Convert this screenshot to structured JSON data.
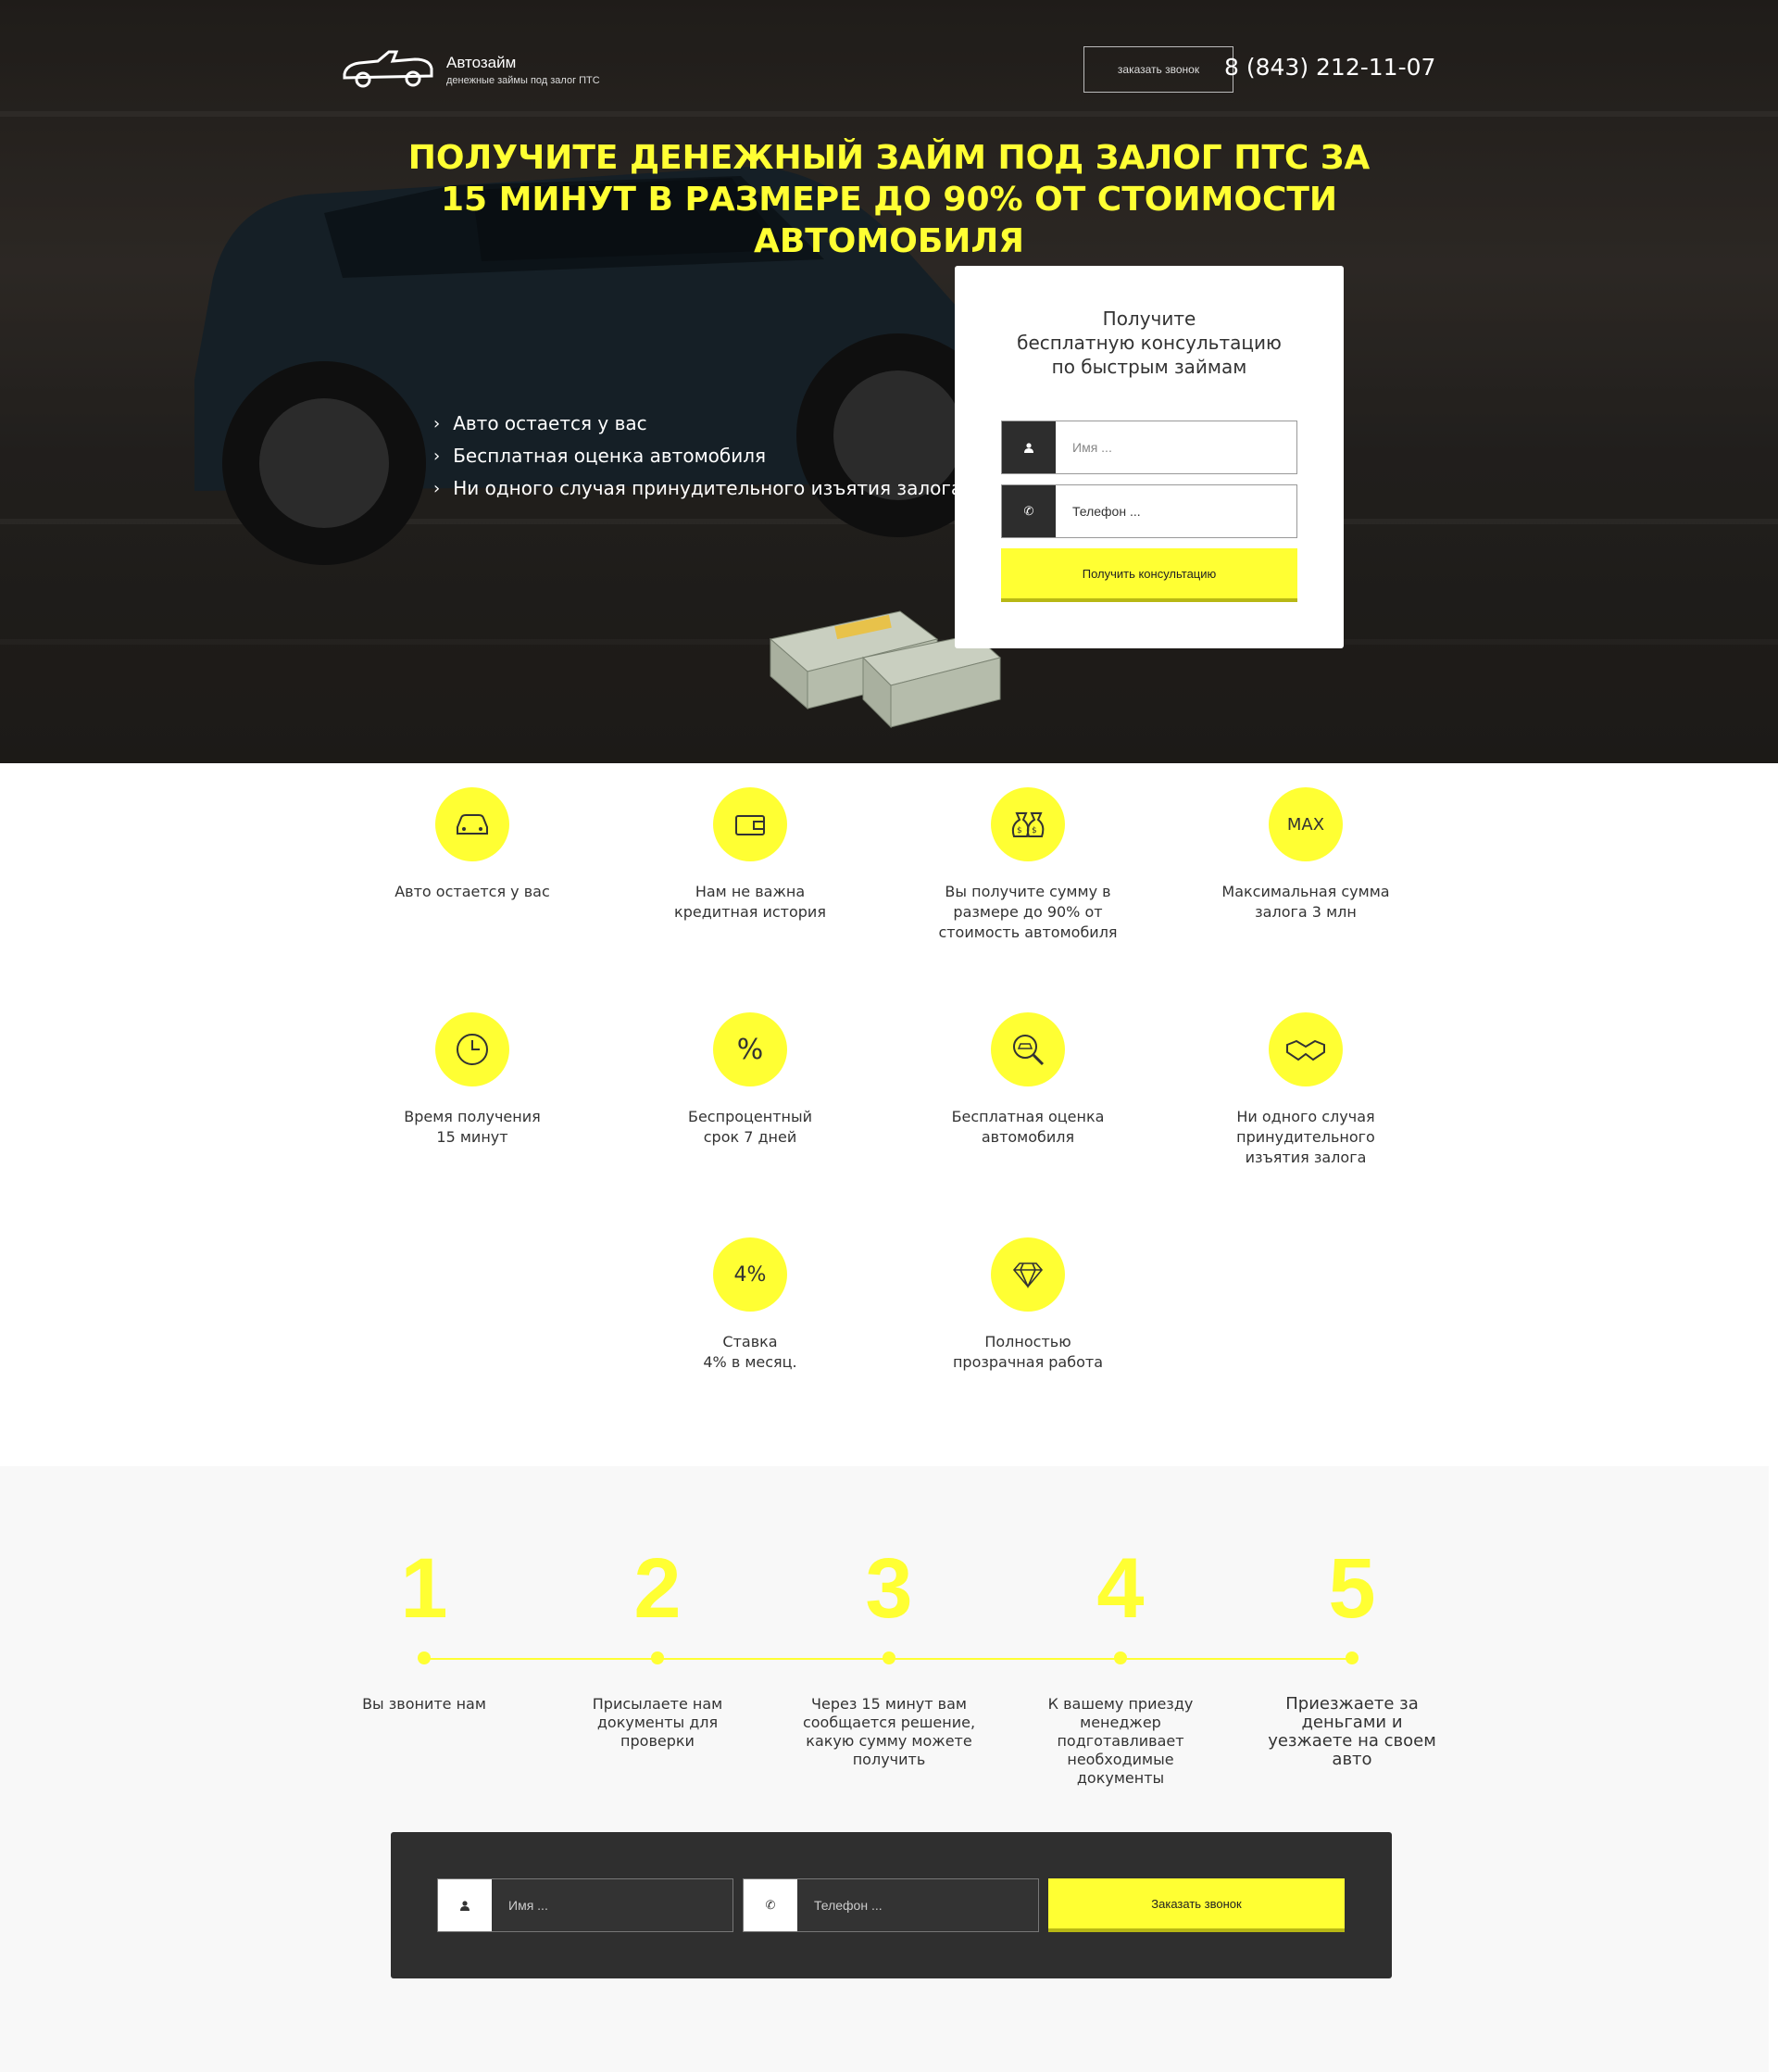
{
  "header": {
    "logo_title": "Автозайм",
    "logo_subtitle": "денежные займы под залог ПТС",
    "callback_button": "заказать звонок",
    "phone": "8 (843) 212-11-07"
  },
  "hero": {
    "headline": "Получите денежный займ под залог ПТС за 15 минут в размере до 90% от стоимости автомобиля",
    "bullets": [
      "Авто остается у вас",
      "Бесплатная оценка автомобиля",
      "Ни одного случая принудительного изъятия залога"
    ]
  },
  "form": {
    "title_line1": "Получите",
    "title_line2": "бесплатную консультацию",
    "title_line3": "по быстрым займам",
    "name_placeholder": "Имя ...",
    "phone_placeholder": "Телефон ...",
    "submit": "Получить консультацию"
  },
  "features": [
    {
      "icon": "car-icon",
      "label": "Авто остается у вас"
    },
    {
      "icon": "wallet-icon",
      "label": "Нам не важна\nкредитная история"
    },
    {
      "icon": "money-bags-icon",
      "label": "Вы получите сумму в\nразмере до 90% от\nстоимость автомобиля"
    },
    {
      "icon": "max-icon",
      "icon_text": "MAX",
      "label": "Максимальная сумма\nзалога 3 млн"
    },
    {
      "icon": "clock-icon",
      "label": "Время получения\n15 минут"
    },
    {
      "icon": "percent-icon",
      "icon_text": "%",
      "label": "Беспроцентный\nсрок 7 дней"
    },
    {
      "icon": "car-search-icon",
      "label": "Бесплатная оценка\nавтомобиля"
    },
    {
      "icon": "handshake-icon",
      "label": "Ни одного случая\nпринудительного\nизъятия залога"
    },
    {
      "icon": "rate-icon",
      "icon_text": "4%",
      "label": "Ставка\n4% в месяц."
    },
    {
      "icon": "diamond-icon",
      "label": "Полностью\nпрозрачная работа"
    }
  ],
  "steps": [
    {
      "num": "1",
      "desc": "Вы звоните нам"
    },
    {
      "num": "2",
      "desc": "Присылаете нам\nдокументы для\nпроверки"
    },
    {
      "num": "3",
      "desc": "Через 15 минут вам\nсообщается решение,\nкакую сумму можете\nполучить"
    },
    {
      "num": "4",
      "desc": "К вашему приезду\nменеджер\nподготавливает\nнеобходимые\nдокументы"
    },
    {
      "num": "5",
      "desc": "Приезжаете за\nденьгами и\nуезжаете на своем\nавто"
    }
  ],
  "bottom_form": {
    "name_placeholder": "Имя ...",
    "phone_placeholder": "Телефон ...",
    "submit": "Заказать звонок"
  },
  "colors": {
    "accent": "#ffff33",
    "dark": "#2f2f2f"
  }
}
